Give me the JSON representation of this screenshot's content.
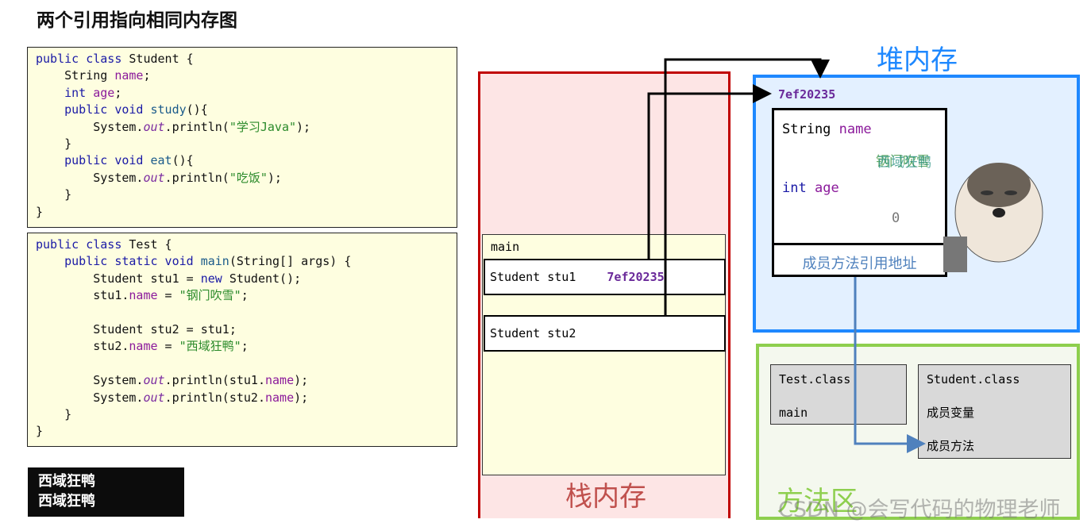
{
  "title": "两个引用指向相同内存图",
  "student_code": [
    [
      [
        "public class ",
        "kw"
      ],
      [
        "Student {",
        ""
      ]
    ],
    [
      [
        "    String ",
        ""
      ],
      [
        "name",
        "fld"
      ],
      [
        ";",
        ""
      ]
    ],
    [
      [
        "    int ",
        "kw"
      ],
      [
        "age",
        "fld"
      ],
      [
        ";",
        ""
      ]
    ],
    [
      [
        "    public void ",
        "kw"
      ],
      [
        "study",
        "mt"
      ],
      [
        "(){",
        ""
      ]
    ],
    [
      [
        "        System.",
        ""
      ],
      [
        "out",
        "it"
      ],
      [
        ".println(",
        ""
      ],
      [
        "\"学习Java\"",
        "st"
      ],
      [
        ");",
        ""
      ]
    ],
    [
      [
        "    }",
        ""
      ]
    ],
    [
      [
        "    public void ",
        "kw"
      ],
      [
        "eat",
        "mt"
      ],
      [
        "(){",
        ""
      ]
    ],
    [
      [
        "        System.",
        ""
      ],
      [
        "out",
        "it"
      ],
      [
        ".println(",
        ""
      ],
      [
        "\"吃饭\"",
        "st"
      ],
      [
        ");",
        ""
      ]
    ],
    [
      [
        "    }",
        ""
      ]
    ],
    [
      [
        "}",
        ""
      ]
    ]
  ],
  "test_code": [
    [
      [
        "public class ",
        "kw"
      ],
      [
        "Test {",
        ""
      ]
    ],
    [
      [
        "    public static void ",
        "kw"
      ],
      [
        "main",
        "mt"
      ],
      [
        "(String[] args) {",
        ""
      ]
    ],
    [
      [
        "        Student stu1 = ",
        ""
      ],
      [
        "new ",
        "kw"
      ],
      [
        "Student();",
        ""
      ]
    ],
    [
      [
        "        stu1.",
        ""
      ],
      [
        "name",
        "fld"
      ],
      [
        " = ",
        ""
      ],
      [
        "\"钢门吹雪\"",
        "st"
      ],
      [
        ";",
        ""
      ]
    ],
    [
      [
        "",
        ""
      ]
    ],
    [
      [
        "        Student stu2 = stu1;",
        ""
      ]
    ],
    [
      [
        "        stu2.",
        ""
      ],
      [
        "name",
        "fld"
      ],
      [
        " = ",
        ""
      ],
      [
        "\"西域狂鸭\"",
        "st"
      ],
      [
        ";",
        ""
      ]
    ],
    [
      [
        "",
        ""
      ]
    ],
    [
      [
        "        System.",
        ""
      ],
      [
        "out",
        "it"
      ],
      [
        ".println(stu1.",
        ""
      ],
      [
        "name",
        "fld"
      ],
      [
        ");",
        ""
      ]
    ],
    [
      [
        "        System.",
        ""
      ],
      [
        "out",
        "it"
      ],
      [
        ".println(stu2.",
        ""
      ],
      [
        "name",
        "fld"
      ],
      [
        ");",
        ""
      ]
    ],
    [
      [
        "    }",
        ""
      ]
    ],
    [
      [
        "}",
        ""
      ]
    ]
  ],
  "console": {
    "lines": [
      "西域狂鸭",
      "西域狂鸭"
    ]
  },
  "stack": {
    "label": "栈内存",
    "frame": "main",
    "vars": [
      {
        "decl": "Student stu1",
        "value": "7ef20235"
      },
      {
        "decl": "Student stu2",
        "value": ""
      }
    ]
  },
  "heap": {
    "label": "堆内存",
    "address": "7ef20235",
    "field1_type": "String",
    "field1_name": "name",
    "field1_value_old": "钢门吹雪",
    "field1_value_new": "西域狂鸭",
    "field2_type": "int",
    "field2_name": "age",
    "field2_value": "0",
    "method_ref": "成员方法引用地址"
  },
  "method_area": {
    "label": "方法区",
    "test_class": {
      "name": "Test.class",
      "item": "main"
    },
    "student_class": {
      "name": "Student.class",
      "items": [
        "成员变量",
        "成员方法"
      ]
    }
  },
  "watermark": "CSDN @会写代码的物理老师",
  "colors": {
    "stack": "#c00000",
    "heap": "#1e88ff",
    "method_area": "#8ecf4e",
    "arrow_method": "#4f81bd"
  }
}
